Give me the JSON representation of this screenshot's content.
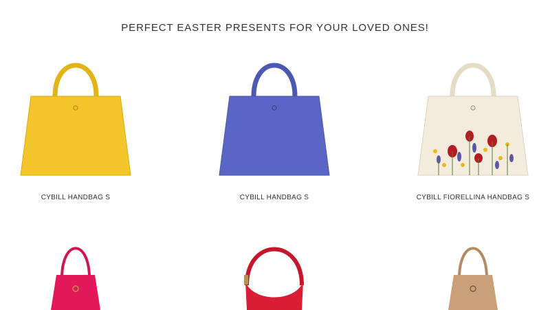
{
  "heading": "PERFECT EASTER PRESENTS FOR YOUR LOVED ONES!",
  "products": [
    {
      "name": "CYBILL HANDBAG S",
      "color": "#f2c62a"
    },
    {
      "name": "CYBILL HANDBAG S",
      "color": "#5a66c4"
    },
    {
      "name": "CYBILL FIORELLINA HANDBAG S",
      "color": "#f3ecdc"
    },
    {
      "color": "#e3185a"
    },
    {
      "color": "#d81d35"
    },
    {
      "color": "#c9a07a"
    }
  ]
}
